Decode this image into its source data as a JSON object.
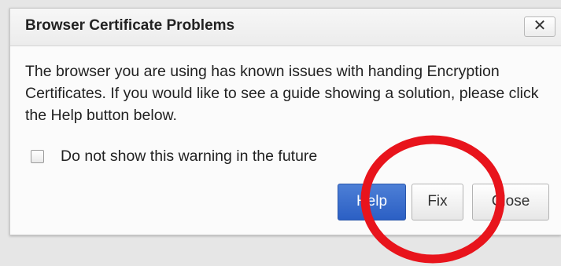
{
  "dialog": {
    "title": "Browser Certificate Problems",
    "close_glyph": "✕",
    "message": "The browser you are using has known issues with handing Encryption Certificates. If you would like to see a guide showing a solution, please click the Help button below.",
    "checkbox_label": "Do not show this warning in the future",
    "checkbox_checked": false,
    "buttons": {
      "help": "Help",
      "fix": "Fix",
      "close": "Close"
    }
  },
  "annotation": {
    "shape": "circle",
    "color": "#e8141c"
  },
  "colors": {
    "primary_button": "#2f63c8",
    "dialog_background": "#fbfbfb"
  }
}
